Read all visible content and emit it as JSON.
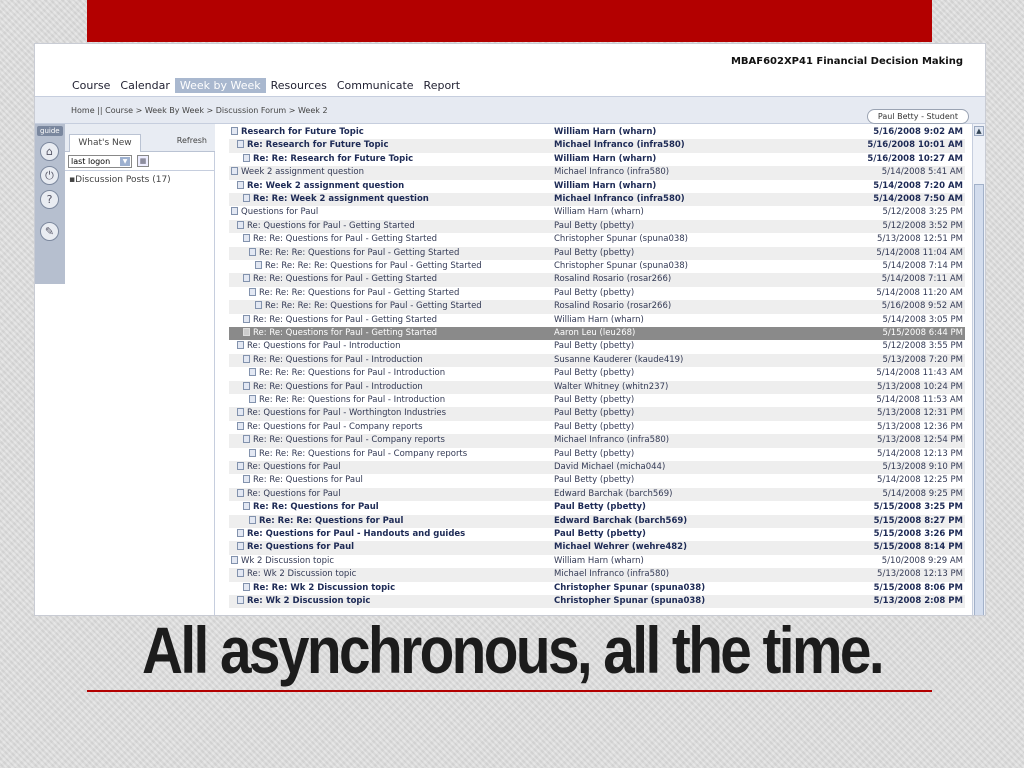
{
  "colors": {
    "accent_red": "#b30000",
    "nav_active": "#a9b8cf",
    "row_alt": "#eeeeee",
    "row_highlight": "#8a8a8a"
  },
  "course": {
    "title": "MBAF602XP41 Financial Decision Making"
  },
  "nav": {
    "tabs": [
      "Course",
      "Calendar",
      "Week by Week",
      "Resources",
      "Communicate",
      "Report"
    ],
    "active": "Week by Week"
  },
  "breadcrumb": "Home || Course > Week By Week > Discussion Forum > Week 2",
  "user": "Paul Betty - Student",
  "tools": {
    "guide_label": "guide",
    "icons": [
      "home-icon",
      "power-icon",
      "help-icon",
      "wrench-icon"
    ]
  },
  "left_panel": {
    "tab": "What's New",
    "refresh": "Refresh",
    "filter_value": "last logon",
    "item": "Discussion Posts (17)"
  },
  "posts": [
    {
      "subject": "Research for Future Topic",
      "author": "William Harn (wharn)",
      "date": "5/16/2008 9:02 AM",
      "indent": 0,
      "bold": true
    },
    {
      "subject": "Re: Research for Future Topic",
      "author": "Michael Infranco (infra580)",
      "date": "5/16/2008 10:01 AM",
      "indent": 1,
      "bold": true
    },
    {
      "subject": "Re: Re: Research for Future Topic",
      "author": "William Harn (wharn)",
      "date": "5/16/2008 10:27 AM",
      "indent": 2,
      "bold": true
    },
    {
      "subject": "Week 2 assignment question",
      "author": "Michael Infranco (infra580)",
      "date": "5/14/2008 5:41 AM",
      "indent": 0,
      "bold": false
    },
    {
      "subject": "Re: Week 2 assignment question",
      "author": "William Harn (wharn)",
      "date": "5/14/2008 7:20 AM",
      "indent": 1,
      "bold": true
    },
    {
      "subject": "Re: Re: Week 2 assignment question",
      "author": "Michael Infranco (infra580)",
      "date": "5/14/2008 7:50 AM",
      "indent": 2,
      "bold": true
    },
    {
      "subject": "Questions for Paul",
      "author": "William Harn (wharn)",
      "date": "5/12/2008 3:25 PM",
      "indent": 0,
      "bold": false
    },
    {
      "subject": "Re: Questions for Paul - Getting Started",
      "author": "Paul Betty (pbetty)",
      "date": "5/12/2008 3:52 PM",
      "indent": 1,
      "bold": false
    },
    {
      "subject": "Re: Re: Questions for Paul - Getting Started",
      "author": "Christopher Spunar (spuna038)",
      "date": "5/13/2008 12:51 PM",
      "indent": 2,
      "bold": false
    },
    {
      "subject": "Re: Re: Re: Questions for Paul - Getting Started",
      "author": "Paul Betty (pbetty)",
      "date": "5/14/2008 11:04 AM",
      "indent": 3,
      "bold": false
    },
    {
      "subject": "Re: Re: Re: Re: Questions for Paul - Getting Started",
      "author": "Christopher Spunar (spuna038)",
      "date": "5/14/2008 7:14 PM",
      "indent": 4,
      "bold": false
    },
    {
      "subject": "Re: Re: Questions for Paul - Getting Started",
      "author": "Rosalind Rosario (rosar266)",
      "date": "5/14/2008 7:11 AM",
      "indent": 2,
      "bold": false
    },
    {
      "subject": "Re: Re: Re: Questions for Paul - Getting Started",
      "author": "Paul Betty (pbetty)",
      "date": "5/14/2008 11:20 AM",
      "indent": 3,
      "bold": false
    },
    {
      "subject": "Re: Re: Re: Re: Questions for Paul - Getting Started",
      "author": "Rosalind Rosario (rosar266)",
      "date": "5/16/2008 9:52 AM",
      "indent": 4,
      "bold": false
    },
    {
      "subject": "Re: Re: Questions for Paul - Getting Started",
      "author": "William Harn (wharn)",
      "date": "5/14/2008 3:05 PM",
      "indent": 2,
      "bold": false
    },
    {
      "subject": "Re: Re: Questions for Paul - Getting Started",
      "author": "Aaron Leu (leu268)",
      "date": "5/15/2008 6:44 PM",
      "indent": 2,
      "bold": false,
      "highlight": true
    },
    {
      "subject": "Re: Questions for Paul - Introduction",
      "author": "Paul Betty (pbetty)",
      "date": "5/12/2008 3:55 PM",
      "indent": 1,
      "bold": false
    },
    {
      "subject": "Re: Re: Questions for Paul - Introduction",
      "author": "Susanne Kauderer (kaude419)",
      "date": "5/13/2008 7:20 PM",
      "indent": 2,
      "bold": false
    },
    {
      "subject": "Re: Re: Re: Questions for Paul - Introduction",
      "author": "Paul Betty (pbetty)",
      "date": "5/14/2008 11:43 AM",
      "indent": 3,
      "bold": false
    },
    {
      "subject": "Re: Re: Questions for Paul - Introduction",
      "author": "Walter Whitney (whitn237)",
      "date": "5/13/2008 10:24 PM",
      "indent": 2,
      "bold": false
    },
    {
      "subject": "Re: Re: Re: Questions for Paul - Introduction",
      "author": "Paul Betty (pbetty)",
      "date": "5/14/2008 11:53 AM",
      "indent": 3,
      "bold": false
    },
    {
      "subject": "Re: Questions for Paul - Worthington Industries",
      "author": "Paul Betty (pbetty)",
      "date": "5/13/2008 12:31 PM",
      "indent": 1,
      "bold": false
    },
    {
      "subject": "Re: Questions for Paul - Company reports",
      "author": "Paul Betty (pbetty)",
      "date": "5/13/2008 12:36 PM",
      "indent": 1,
      "bold": false
    },
    {
      "subject": "Re: Re: Questions for Paul - Company reports",
      "author": "Michael Infranco (infra580)",
      "date": "5/13/2008 12:54 PM",
      "indent": 2,
      "bold": false
    },
    {
      "subject": "Re: Re: Re: Questions for Paul - Company reports",
      "author": "Paul Betty (pbetty)",
      "date": "5/14/2008 12:13 PM",
      "indent": 3,
      "bold": false
    },
    {
      "subject": "Re: Questions for Paul",
      "author": "David Michael (micha044)",
      "date": "5/13/2008 9:10 PM",
      "indent": 1,
      "bold": false
    },
    {
      "subject": "Re: Re: Questions for Paul",
      "author": "Paul Betty (pbetty)",
      "date": "5/14/2008 12:25 PM",
      "indent": 2,
      "bold": false
    },
    {
      "subject": "Re: Questions for Paul",
      "author": "Edward Barchak (barch569)",
      "date": "5/14/2008 9:25 PM",
      "indent": 1,
      "bold": false
    },
    {
      "subject": "Re: Re: Questions for Paul",
      "author": "Paul Betty (pbetty)",
      "date": "5/15/2008 3:25 PM",
      "indent": 2,
      "bold": true
    },
    {
      "subject": "Re: Re: Re: Questions for Paul",
      "author": "Edward Barchak (barch569)",
      "date": "5/15/2008 8:27 PM",
      "indent": 3,
      "bold": true
    },
    {
      "subject": "Re: Questions for Paul - Handouts and guides",
      "author": "Paul Betty (pbetty)",
      "date": "5/15/2008 3:26 PM",
      "indent": 1,
      "bold": true
    },
    {
      "subject": "Re: Questions for Paul",
      "author": "Michael Wehrer (wehre482)",
      "date": "5/15/2008 8:14 PM",
      "indent": 1,
      "bold": true
    },
    {
      "subject": "Wk 2 Discussion topic",
      "author": "William Harn (wharn)",
      "date": "5/10/2008 9:29 AM",
      "indent": 0,
      "bold": false
    },
    {
      "subject": "Re: Wk 2 Discussion topic",
      "author": "Michael Infranco (infra580)",
      "date": "5/13/2008 12:13 PM",
      "indent": 1,
      "bold": false
    },
    {
      "subject": "Re: Re: Wk 2 Discussion topic",
      "author": "Christopher Spunar (spuna038)",
      "date": "5/15/2008 8:06 PM",
      "indent": 2,
      "bold": true
    },
    {
      "subject": "Re: Wk 2 Discussion topic",
      "author": "Christopher Spunar (spuna038)",
      "date": "5/13/2008 2:08 PM",
      "indent": 1,
      "bold": true
    }
  ],
  "caption": "All asynchronous, all the time."
}
